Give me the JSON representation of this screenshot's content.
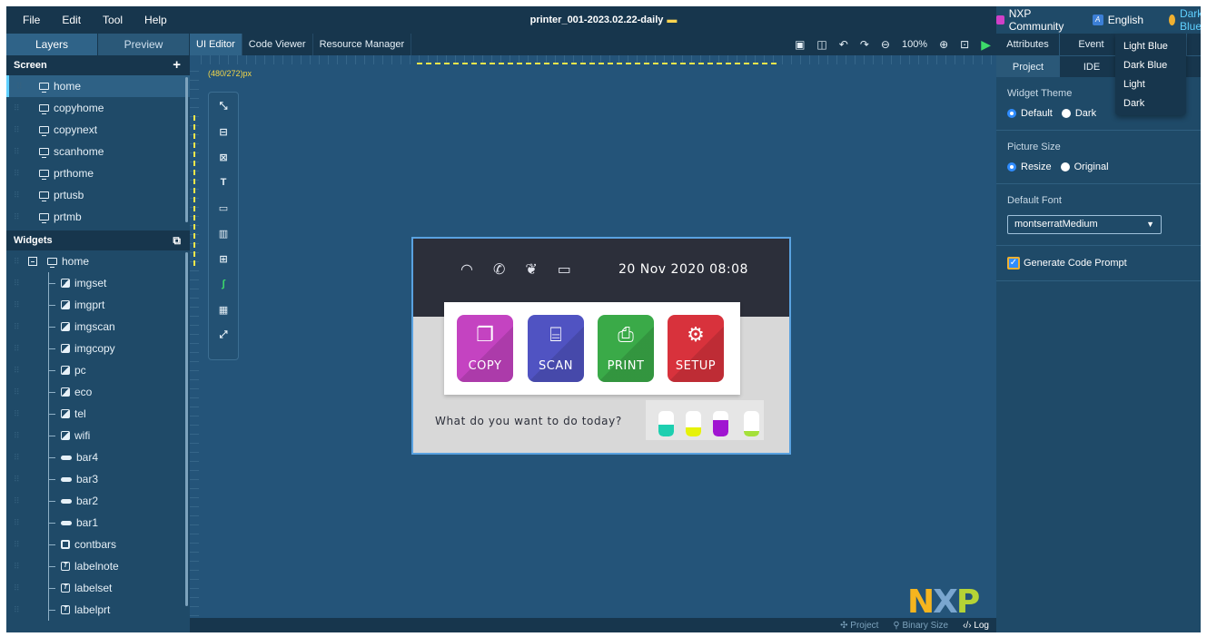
{
  "menu": {
    "items": [
      "File",
      "Edit",
      "Tool",
      "Help"
    ],
    "title": "printer_001-2023.02.22-daily",
    "community": "NXP Community",
    "language": "English",
    "theme": "Dark Blue"
  },
  "theme_menu": [
    "Light Blue",
    "Dark Blue",
    "Light",
    "Dark"
  ],
  "left_tabs": [
    "Layers",
    "Preview"
  ],
  "screen_section": {
    "title": "Screen",
    "add": "+"
  },
  "screens": [
    "home",
    "copyhome",
    "copynext",
    "scanhome",
    "prthome",
    "prtusb",
    "prtmb"
  ],
  "widgets_section": {
    "title": "Widgets"
  },
  "widget_tree": {
    "root": "home",
    "children": [
      {
        "name": "imgset",
        "icon": "image-icon"
      },
      {
        "name": "imgprt",
        "icon": "image-icon"
      },
      {
        "name": "imgscan",
        "icon": "image-icon"
      },
      {
        "name": "imgcopy",
        "icon": "image-icon"
      },
      {
        "name": "pc",
        "icon": "image-icon"
      },
      {
        "name": "eco",
        "icon": "image-icon"
      },
      {
        "name": "tel",
        "icon": "image-icon"
      },
      {
        "name": "wifi",
        "icon": "image-icon"
      },
      {
        "name": "bar4",
        "icon": "bar-icon"
      },
      {
        "name": "bar3",
        "icon": "bar-icon"
      },
      {
        "name": "bar2",
        "icon": "bar-icon"
      },
      {
        "name": "bar1",
        "icon": "bar-icon"
      },
      {
        "name": "contbars",
        "icon": "container-icon"
      },
      {
        "name": "labelnote",
        "icon": "label-icon"
      },
      {
        "name": "labelset",
        "icon": "label-icon"
      },
      {
        "name": "labelprt",
        "icon": "label-icon"
      }
    ]
  },
  "center_tabs": [
    "UI Editor",
    "Code Viewer",
    "Resource Manager"
  ],
  "zoom": "100%",
  "canvas_size": "(480/272)px",
  "status": {
    "project": "Project",
    "binary": "Binary Size",
    "log": "Log"
  },
  "preview": {
    "date": "20 Nov 2020 08:08",
    "message": "What do you want to do today?",
    "buttons": [
      {
        "label": "COPY",
        "color": "#c443c1",
        "glyph": "❐"
      },
      {
        "label": "SCAN",
        "color": "#5053c2",
        "glyph": "⌸"
      },
      {
        "label": "PRINT",
        "color": "#3aaa48",
        "glyph": "⎙"
      },
      {
        "label": "SETUP",
        "color": "#d8323c",
        "glyph": "⚙"
      }
    ],
    "ink_levels": [
      {
        "color": "#1ecfb0",
        "level": 0.45
      },
      {
        "color": "#e6f20a",
        "level": 0.35
      },
      {
        "color": "#a015d1",
        "level": 0.65
      },
      {
        "color": "#a5e03a",
        "level": 0.2
      }
    ]
  },
  "right_tabs": [
    "Attributes",
    "Event"
  ],
  "right_subtabs": [
    "Project",
    "IDE"
  ],
  "ide": {
    "widget_theme_label": "Widget Theme",
    "widget_theme_options": [
      "Default",
      "Dark"
    ],
    "picture_size_label": "Picture Size",
    "picture_size_options": [
      "Resize",
      "Original"
    ],
    "default_font_label": "Default Font",
    "default_font_value": "montserratMedium",
    "generate_code_prompt": "Generate Code Prompt"
  }
}
